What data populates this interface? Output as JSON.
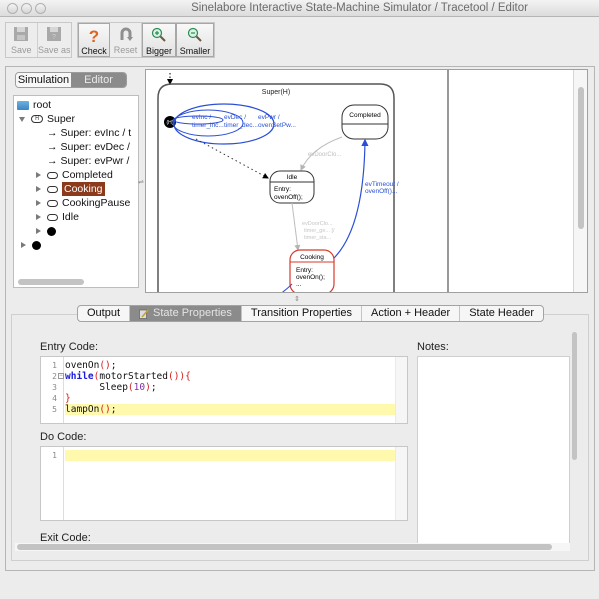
{
  "window": {
    "title": "Sinelabore Interactive State-Machine Simulator / Tracetool / Editor"
  },
  "toolbar": {
    "buttons": [
      {
        "label": "Save",
        "icon": "floppy-icon",
        "enabled": false
      },
      {
        "label": "Save as",
        "icon": "floppy-as-icon",
        "enabled": false
      },
      {
        "label": "Check",
        "icon": "question-icon",
        "enabled": true
      },
      {
        "label": "Reset",
        "icon": "reset-icon",
        "enabled": false
      },
      {
        "label": "Bigger",
        "icon": "zoom-in-icon",
        "enabled": true
      },
      {
        "label": "Smaller",
        "icon": "zoom-out-icon",
        "enabled": true
      }
    ]
  },
  "left_panel": {
    "mode_tabs": [
      {
        "label": "Simulation",
        "active": false
      },
      {
        "label": "Editor",
        "active": true
      }
    ],
    "tree": [
      {
        "label": "root",
        "type": "folder",
        "depth": 0
      },
      {
        "label": "Super",
        "type": "history-state",
        "depth": 1,
        "expanded": true
      },
      {
        "label": "Super: evInc / t",
        "type": "transition",
        "depth": 2
      },
      {
        "label": "Super: evDec /",
        "type": "transition",
        "depth": 2
      },
      {
        "label": "Super: evPwr /",
        "type": "transition",
        "depth": 2
      },
      {
        "label": "Completed",
        "type": "state",
        "depth": 2
      },
      {
        "label": "Cooking",
        "type": "state",
        "depth": 2,
        "selected": true
      },
      {
        "label": "CookingPause",
        "type": "state",
        "depth": 2
      },
      {
        "label": "Idle",
        "type": "state",
        "depth": 2
      },
      {
        "label": "",
        "type": "initial",
        "depth": 2
      },
      {
        "label": "",
        "type": "initial",
        "depth": 0
      }
    ]
  },
  "diagram": {
    "super_state_label": "Super(H)",
    "history_marker": "(H)",
    "states": [
      {
        "name": "Completed",
        "body": ""
      },
      {
        "name": "Idle",
        "body_lines": [
          "Entry:",
          "ovenOff();"
        ]
      },
      {
        "name": "Cooking",
        "body_lines": [
          "Entry:",
          "ovenOn();",
          "..."
        ],
        "selected": true
      }
    ],
    "transitions": [
      {
        "label_lines": [
          "evInc /",
          "timer_inc..."
        ]
      },
      {
        "label_lines": [
          "evDec /",
          "timer_dec..."
        ]
      },
      {
        "label_lines": [
          "evPwr /",
          "ovenSetPw..."
        ]
      },
      {
        "label_lines": [
          "evDoorClo..."
        ]
      },
      {
        "label_lines": [
          "evTimeout /",
          "ovenOff()..."
        ]
      },
      {
        "label_lines": [
          "evDoorClo...",
          "timer_ge... [/",
          "timer_sta..."
        ]
      }
    ],
    "colors": {
      "internal_transition": "#2a4fd6",
      "selected_state": "#d83a2a",
      "dim_transition": "#bdbdbd"
    }
  },
  "bottom_tabs": [
    {
      "label": "Output",
      "active": false
    },
    {
      "label": "State Properties",
      "active": true,
      "icon": "edit-icon"
    },
    {
      "label": "Transition Properties",
      "active": false
    },
    {
      "label": "Action + Header",
      "active": false
    },
    {
      "label": "State Header",
      "active": false
    }
  ],
  "properties": {
    "entry_label": "Entry Code:",
    "entry_lines": [
      {
        "n": "1",
        "code": "ovenOn();"
      },
      {
        "n": "2",
        "code": "while(motorStarted()){"
      },
      {
        "n": "3",
        "code": "      Sleep(10);"
      },
      {
        "n": "4",
        "code": "}"
      },
      {
        "n": "5",
        "code": "lampOn();"
      }
    ],
    "do_label": "Do Code:",
    "do_lines": [
      {
        "n": "1",
        "code": ""
      }
    ],
    "exit_label": "Exit Code:",
    "notes_label": "Notes:",
    "notes_value": ""
  }
}
